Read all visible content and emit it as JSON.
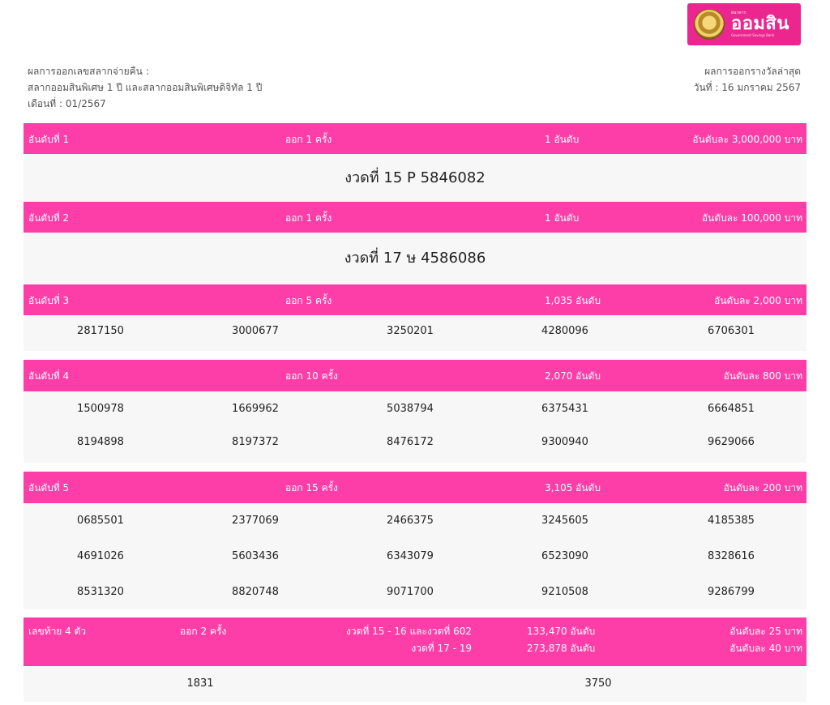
{
  "logo": {
    "small": "ธนาคาร",
    "main": "ออมสิน",
    "sub": "Government Savings Bank"
  },
  "header": {
    "left_lines": [
      "ผลการออกเลขสลากจ่ายคืน :",
      "สลากออมสินพิเศษ 1 ปี และสลากออมสินพิเศษดิจิทัล 1 ปี",
      "เดือนที่ : 01/2567"
    ],
    "right_lines": [
      "ผลการออกรางวัลล่าสุด",
      "วันที่ : 16 มกราคม 2567"
    ]
  },
  "ranks": [
    {
      "rank": "อันดับที่ 1",
      "draws": "ออก 1 ครั้ง",
      "count": "1 อันดับ",
      "prize": "อันดับละ 3,000,000 บาท",
      "winner": "งวดที่ 15 P 5846082"
    },
    {
      "rank": "อันดับที่ 2",
      "draws": "ออก 1 ครั้ง",
      "count": "1 อันดับ",
      "prize": "อันดับละ 100,000 บาท",
      "winner": "งวดที่ 17 ษ 4586086"
    },
    {
      "rank": "อันดับที่ 3",
      "draws": "ออก 5 ครั้ง",
      "count": "1,035 อันดับ",
      "prize": "อันดับละ 2,000 บาท",
      "numbers": [
        [
          "2817150",
          "3000677",
          "3250201",
          "4280096",
          "6706301"
        ]
      ]
    },
    {
      "rank": "อันดับที่ 4",
      "draws": "ออก 10 ครั้ง",
      "count": "2,070 อันดับ",
      "prize": "อันดับละ 800 บาท",
      "numbers": [
        [
          "1500978",
          "1669962",
          "5038794",
          "6375431",
          "6664851"
        ],
        [
          "8194898",
          "8197372",
          "8476172",
          "9300940",
          "9629066"
        ]
      ]
    },
    {
      "rank": "อันดับที่ 5",
      "draws": "ออก 15 ครั้ง",
      "count": "3,105 อันดับ",
      "prize": "อันดับละ 200 บาท",
      "numbers": [
        [
          "0685501",
          "2377069",
          "2466375",
          "3245605",
          "4185385"
        ],
        [
          "4691026",
          "5603436",
          "6343079",
          "6523090",
          "8328616"
        ],
        [
          "8531320",
          "8820748",
          "9071700",
          "9210508",
          "9286799"
        ]
      ]
    }
  ],
  "last4": {
    "label": "เลขท้าย 4 ตัว",
    "draws": "ออก 2 ครั้ง",
    "period1": "งวดที่ 15 - 16 และงวดที่ 602",
    "period2": "งวดที่ 17 - 19",
    "count1": "133,470 อันดับ",
    "count2": "273,878 อันดับ",
    "prize1": "อันดับละ 25 บาท",
    "prize2": "อันดับละ 40 บาท",
    "numbers": [
      "1831",
      "3750"
    ]
  }
}
